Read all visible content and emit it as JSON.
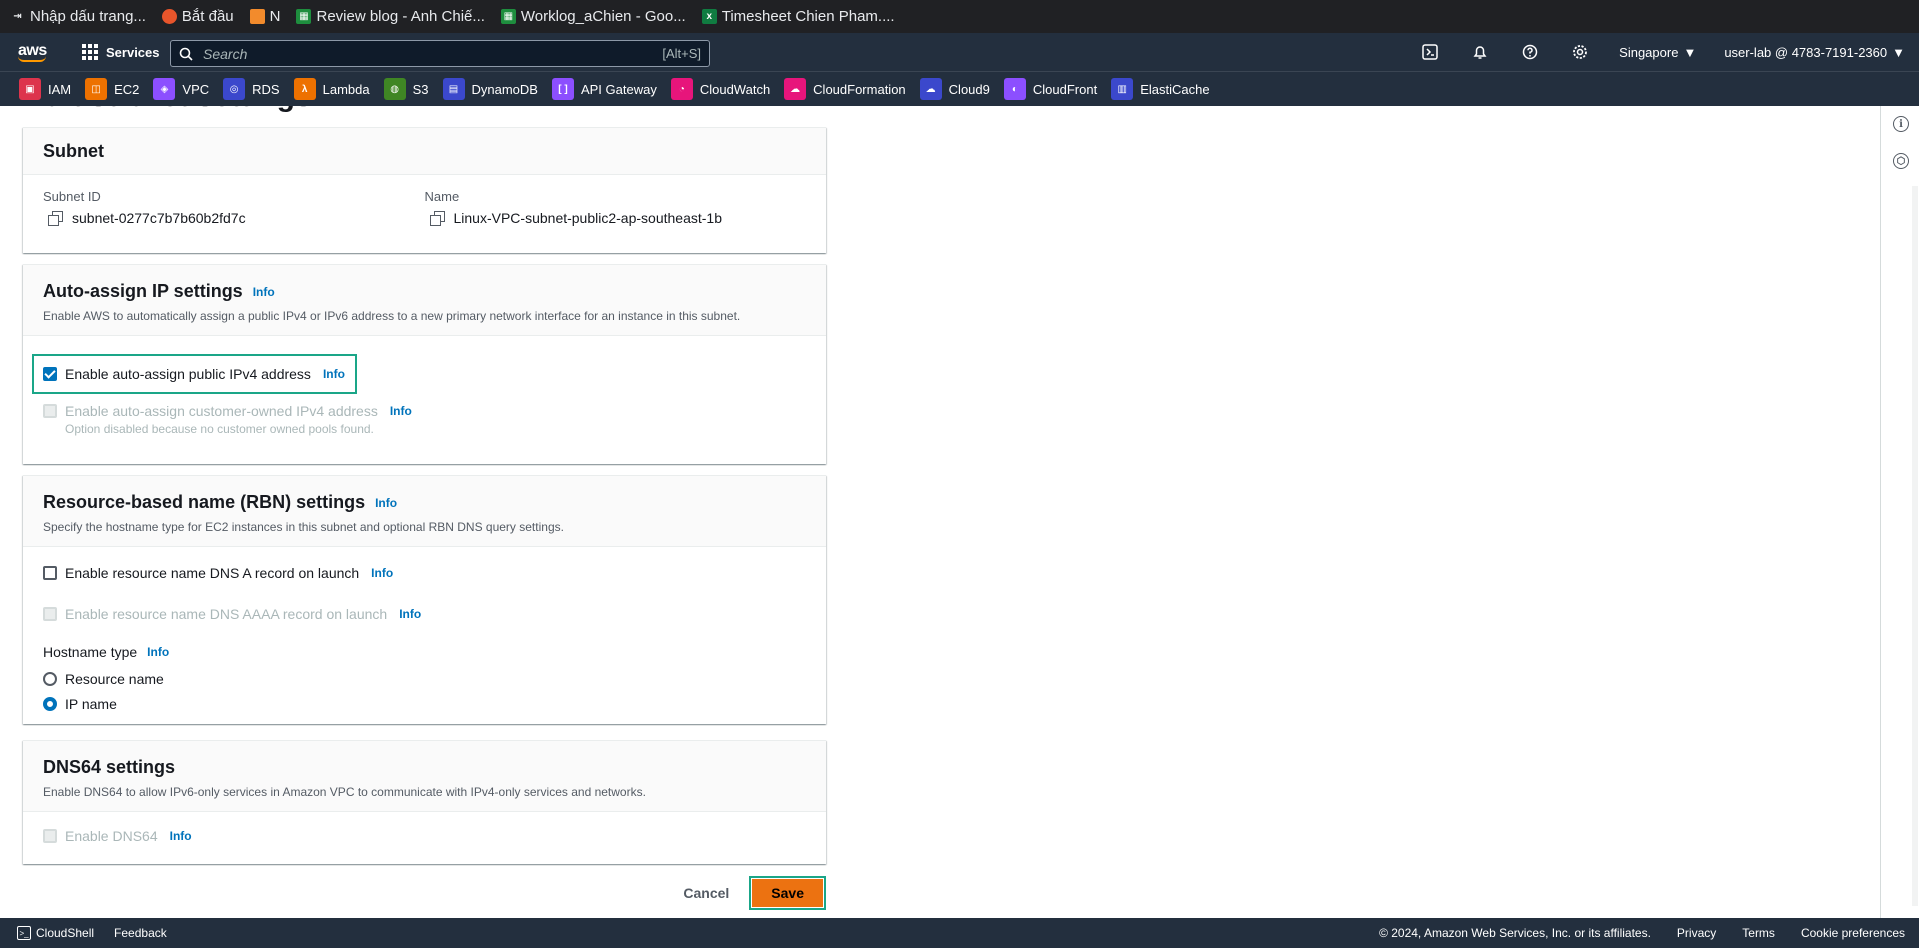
{
  "browser_bookmarks": [
    {
      "label": "Nhập dấu trang...",
      "icon": "import-icon",
      "color": "#202124"
    },
    {
      "label": "Bắt đầu",
      "icon": "firefox-icon",
      "color": "#e8552b"
    },
    {
      "label": "N",
      "icon": "package-icon",
      "color": "#f28b2c"
    },
    {
      "label": "Review blog - Anh Chiế...",
      "icon": "sheets-icon",
      "color": "#1e8e3e"
    },
    {
      "label": "Worklog_aChien - Goo...",
      "icon": "sheets-icon",
      "color": "#1e8e3e"
    },
    {
      "label": "Timesheet Chien Pham....",
      "icon": "excel-icon",
      "color": "#107c41"
    }
  ],
  "header": {
    "logo": "aws",
    "services_label": "Services",
    "search_placeholder": "Search",
    "search_shortcut": "[Alt+S]",
    "region": "Singapore",
    "user": "user-lab @ 4783-7191-2360"
  },
  "favorites": [
    {
      "label": "IAM",
      "color": "#dd344c"
    },
    {
      "label": "EC2",
      "color": "#ed7100"
    },
    {
      "label": "VPC",
      "color": "#8c4fff"
    },
    {
      "label": "RDS",
      "color": "#3b48cc"
    },
    {
      "label": "Lambda",
      "color": "#ed7100"
    },
    {
      "label": "S3",
      "color": "#3f8624"
    },
    {
      "label": "DynamoDB",
      "color": "#3b48cc"
    },
    {
      "label": "API Gateway",
      "color": "#8c4fff"
    },
    {
      "label": "CloudWatch",
      "color": "#e7157b"
    },
    {
      "label": "CloudFormation",
      "color": "#e7157b"
    },
    {
      "label": "Cloud9",
      "color": "#3b48cc"
    },
    {
      "label": "CloudFront",
      "color": "#8c4fff"
    },
    {
      "label": "ElastiCache",
      "color": "#3b48cc"
    }
  ],
  "page": {
    "title_cut": "Edit subnet settings"
  },
  "subnet_panel": {
    "title": "Subnet",
    "subnet_id_label": "Subnet ID",
    "subnet_id": "subnet-0277c7b7b60b2fd7c",
    "name_label": "Name",
    "name": "Linux-VPC-subnet-public2-ap-southeast-1b"
  },
  "auto_assign": {
    "title": "Auto-assign IP settings",
    "info": "Info",
    "description": "Enable AWS to automatically assign a public IPv4 or IPv6 address to a new primary network interface for an instance in this subnet.",
    "ipv4_label": "Enable auto-assign public IPv4 address",
    "ipv4_checked": true,
    "customer_owned_label": "Enable auto-assign customer-owned IPv4 address",
    "customer_owned_note": "Option disabled because no customer owned pools found."
  },
  "rbn": {
    "title": "Resource-based name (RBN) settings",
    "info": "Info",
    "description": "Specify the hostname type for EC2 instances in this subnet and optional RBN DNS query settings.",
    "dns_a_label": "Enable resource name DNS A record on launch",
    "dns_aaaa_label": "Enable resource name DNS AAAA record on launch",
    "hostname_type_label": "Hostname type",
    "options": [
      {
        "label": "Resource name",
        "selected": false
      },
      {
        "label": "IP name",
        "selected": true
      }
    ]
  },
  "dns64": {
    "title": "DNS64 settings",
    "info": "Info",
    "description": "Enable DNS64 to allow IPv6-only services in Amazon VPC to communicate with IPv4-only services and networks.",
    "enable_label": "Enable DNS64"
  },
  "actions": {
    "cancel": "Cancel",
    "save": "Save"
  },
  "footer": {
    "cloudshell": "CloudShell",
    "feedback": "Feedback",
    "copyright": "© 2024, Amazon Web Services, Inc. or its affiliates.",
    "privacy": "Privacy",
    "terms": "Terms",
    "cookies": "Cookie preferences"
  }
}
